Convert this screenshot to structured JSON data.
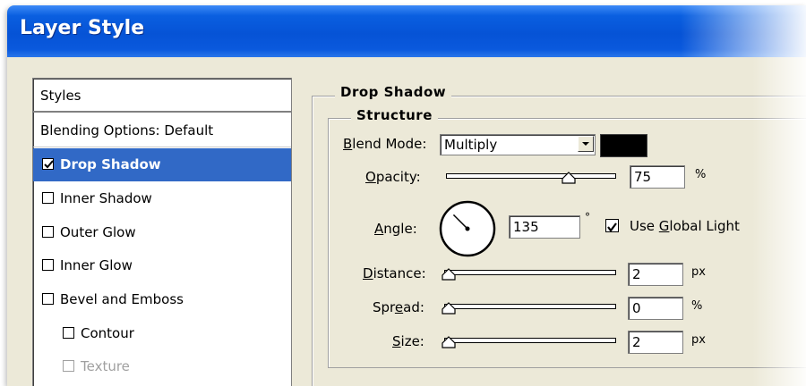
{
  "window": {
    "title": "Layer Style"
  },
  "styles": {
    "header": "Styles",
    "blending": "Blending Options: Default",
    "items": [
      {
        "label": "Drop Shadow",
        "checked": true,
        "selected": true,
        "disabled": false
      },
      {
        "label": "Inner Shadow",
        "checked": false,
        "selected": false,
        "disabled": false
      },
      {
        "label": "Outer Glow",
        "checked": false,
        "selected": false,
        "disabled": false
      },
      {
        "label": "Inner Glow",
        "checked": false,
        "selected": false,
        "disabled": false
      },
      {
        "label": "Bevel and Emboss",
        "checked": false,
        "selected": false,
        "disabled": false
      },
      {
        "label": "Contour",
        "checked": false,
        "selected": false,
        "disabled": false
      },
      {
        "label": "Texture",
        "checked": false,
        "selected": false,
        "disabled": true
      }
    ]
  },
  "drop_shadow": {
    "section_title": "Drop Shadow",
    "structure_title": "Structure",
    "blend_mode": {
      "label_underlined": "B",
      "label_rest": "lend Mode:",
      "value": "Multiply",
      "swatch_color": "#000000"
    },
    "opacity": {
      "label_underlined": "O",
      "label_rest": "pacity:",
      "value": "75",
      "unit": "%",
      "level": 0.75
    },
    "angle": {
      "label_underlined": "A",
      "label_rest": "ngle:",
      "value": "135",
      "unit": "°",
      "degrees": 135
    },
    "global_light": {
      "checked": true,
      "label_before": "Use ",
      "label_underlined": "G",
      "label_after": "lobal Light"
    },
    "distance": {
      "label_underlined": "D",
      "label_rest": "istance:",
      "value": "2",
      "unit": "px",
      "level": 0.0
    },
    "spread": {
      "label_before": "Spr",
      "label_underlined": "e",
      "label_after": "ad:",
      "value": "0",
      "unit": "%",
      "level": 0.0
    },
    "size": {
      "label_underlined": "S",
      "label_rest": "ize:",
      "value": "2",
      "unit": "px",
      "level": 0.0
    }
  },
  "colors": {
    "titlebar": "#0653d6",
    "selection": "#3169c6",
    "dialog_bg": "#ece9d8"
  }
}
